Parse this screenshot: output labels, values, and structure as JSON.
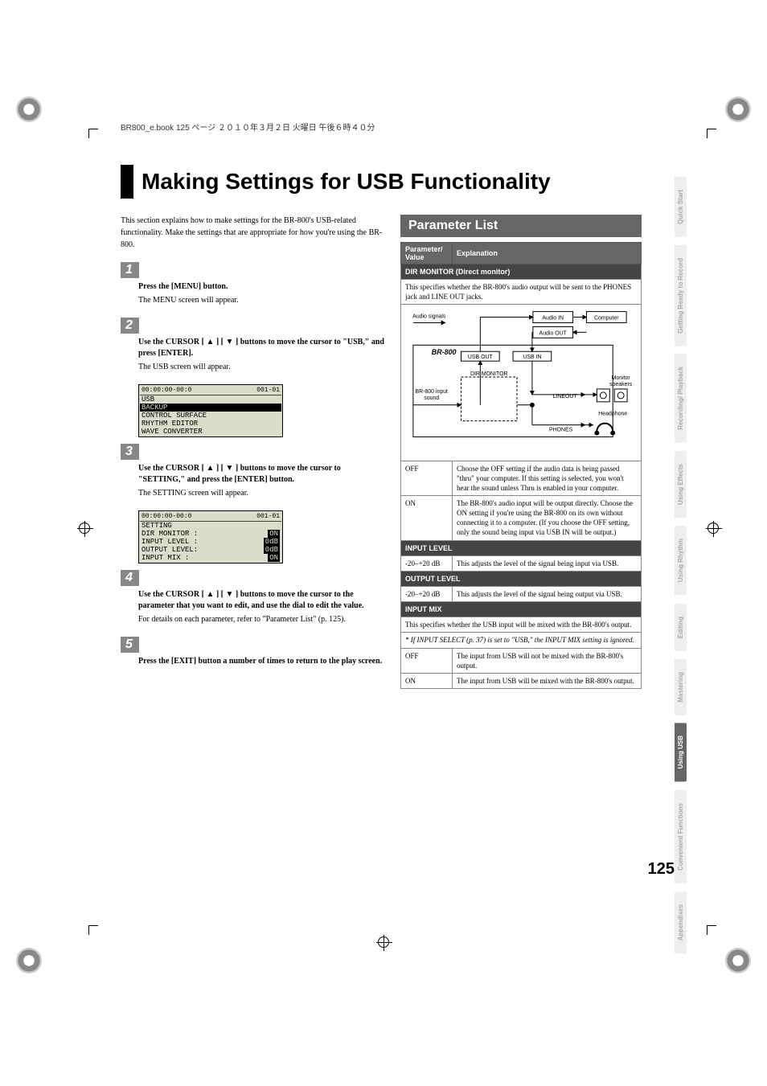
{
  "header_line": "BR800_e.book 125 ページ ２０１０年３月２日 火曜日 午後６時４０分",
  "title": "Making Settings for USB Functionality",
  "intro": "This section explains how to make settings for the BR-800's USB-related functionality. Make the settings that are appropriate for how you're using the BR-800.",
  "steps": [
    {
      "num": "1",
      "bold": "Press the [MENU] button.",
      "text": "The MENU screen will appear."
    },
    {
      "num": "2",
      "bold": "Use the CURSOR [ ▲ ] [ ▼ ] buttons to move the cursor to \"USB,\" and press [ENTER].",
      "text": "The USB screen will appear."
    },
    {
      "num": "3",
      "bold": "Use the CURSOR [ ▲ ] [ ▼ ] buttons to move the cursor to \"SETTING,\" and press the [ENTER] button.",
      "text": "The SETTING screen will appear."
    },
    {
      "num": "4",
      "bold": "Use the CURSOR [ ▲ ] [ ▼ ] buttons to move the cursor to the parameter that you want to edit, and use the dial to edit the value.",
      "text": "For details on each parameter, refer to \"Parameter List\" (p. 125)."
    },
    {
      "num": "5",
      "bold": "Press the [EXIT] button a number of times to return to the play screen.",
      "text": ""
    }
  ],
  "lcd1": {
    "time": "00:00:00-00:0",
    "marker": "001-01",
    "title": "USB",
    "rows": [
      "BACKUP",
      "CONTROL SURFACE",
      "RHYTHM EDITOR",
      "WAVE CONVERTER"
    ]
  },
  "lcd2": {
    "time": "00:00:00-00:0",
    "marker": "001-01",
    "title": "SETTING",
    "rows": [
      {
        "label": "DIR MONITOR :",
        "val": "ON"
      },
      {
        "label": "INPUT LEVEL :",
        "val": "0dB"
      },
      {
        "label": "OUTPUT LEVEL:",
        "val": "0dB"
      },
      {
        "label": "INPUT MIX   :",
        "val": "ON"
      }
    ]
  },
  "param_head": "Parameter List",
  "param_col1": "Parameter/\nValue",
  "param_col2": "Explanation",
  "rows": {
    "dir_monitor_head": "DIR MONITOR (Direct monitor)",
    "dir_monitor_desc": "This specifies whether the BR-800's audio output will be sent to the PHONES jack and LINE OUT jacks.",
    "diagram": {
      "audio_signals": "Audio signals",
      "audio_in": "Audio IN",
      "audio_out": "Audio OUT",
      "computer": "Computer",
      "br800": "BR-800",
      "usb_out": "USB OUT",
      "usb_in": "USB IN",
      "dir_monitor": "DIR MONITOR",
      "br800_input_sound": "BR-800 input\nsound",
      "lineout": "LINEOUT",
      "phones": "PHONES",
      "monitor_speakers": "Monitor\nspeakers",
      "headphone": "Headphone"
    },
    "off1": "OFF",
    "off1_text": "Choose the OFF setting if the audio data is being passed \"thru\" your computer.\nIf this setting is selected, you won't hear the sound unless Thru is enabled in your computer.",
    "on1": "ON",
    "on1_text": "The BR-800's audio input will be output directly. Choose the ON setting if you're using the BR-800 on its own without connecting it to a computer. (If you choose the OFF setting, only the sound being input via USB IN will be output.)",
    "input_level_head": "INPUT LEVEL",
    "input_level_val": "-20–+20 dB",
    "input_level_text": "This adjusts the level of the signal being input via USB.",
    "output_level_head": "OUTPUT LEVEL",
    "output_level_val": "-20–+20 dB",
    "output_level_text": "This adjusts the level of the signal being output via USB.",
    "input_mix_head": "INPUT MIX",
    "input_mix_desc": "This specifies whether the USB input will be mixed with the BR-800's output.",
    "input_mix_note": "* If INPUT SELECT (p. 37) is set to \"USB,\" the INPUT MIX setting is ignored.",
    "off2": "OFF",
    "off2_text": "The input from USB will not be mixed with the BR-800's output.",
    "on2": "ON",
    "on2_text": "The input from USB will be mixed with the BR-800's output."
  },
  "tabs": [
    "Quick Start",
    "Getting Ready\nto Record",
    "Recording/\nPlayback",
    "Using\nEffects",
    "Using\nRhythm",
    "Editing",
    "Mastering",
    "Using USB",
    "Convenient\nFunctions",
    "Appendixes"
  ],
  "active_tab": 7,
  "page_number": "125"
}
